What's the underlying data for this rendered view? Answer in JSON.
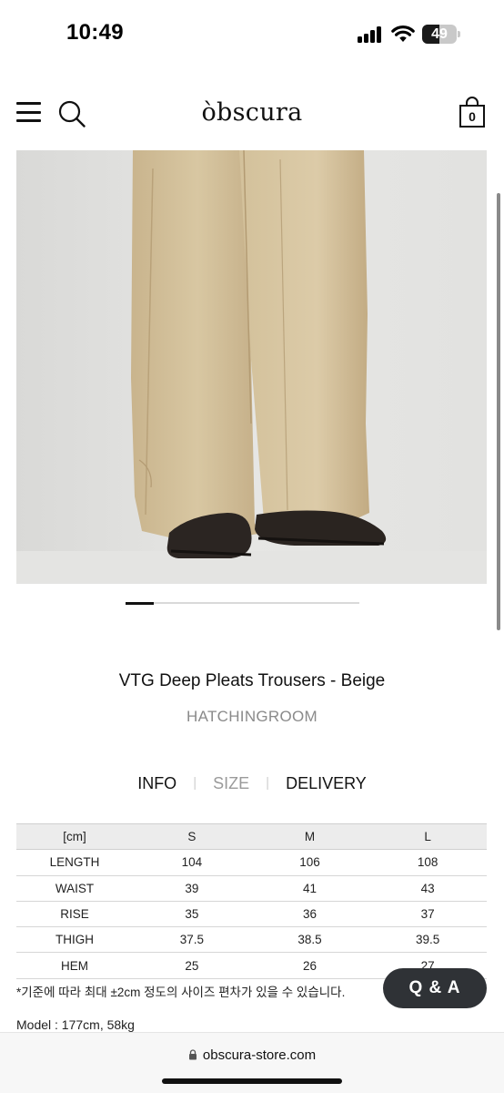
{
  "status_bar": {
    "time": "10:49",
    "battery_level": "49",
    "battery_fraction": 0.49,
    "icons": [
      "signal-icon",
      "wifi-icon",
      "battery-icon"
    ]
  },
  "header": {
    "logo": "òbscura",
    "cart_count": "0",
    "icons": [
      "menu-icon",
      "search-icon",
      "cart-icon"
    ]
  },
  "carousel": {
    "current": 1,
    "progress_fraction": 0.12
  },
  "product": {
    "title": "VTG Deep Pleats Trousers - Beige",
    "brand": "HATCHINGROOM"
  },
  "tabs": [
    {
      "label": "INFO",
      "active": true
    },
    {
      "label": "SIZE",
      "active": false
    },
    {
      "label": "DELIVERY",
      "active": true
    }
  ],
  "size_table": {
    "headers": [
      "[cm]",
      "S",
      "M",
      "L"
    ],
    "rows": [
      [
        "LENGTH",
        "104",
        "106",
        "108"
      ],
      [
        "WAIST",
        "39",
        "41",
        "43"
      ],
      [
        "RISE",
        "35",
        "36",
        "37"
      ],
      [
        "THIGH",
        "37.5",
        "38.5",
        "39.5"
      ],
      [
        "HEM",
        "25",
        "26",
        "27"
      ]
    ]
  },
  "size_note": "*기준에 따라 최대 ±2cm 정도의 사이즈 편차가 있을 수 있습니다.",
  "model_info": "Model : 177cm, 58kg",
  "qa_button": "Q & A",
  "browser": {
    "url": "obscura-store.com",
    "icons": [
      "lock-icon"
    ]
  }
}
